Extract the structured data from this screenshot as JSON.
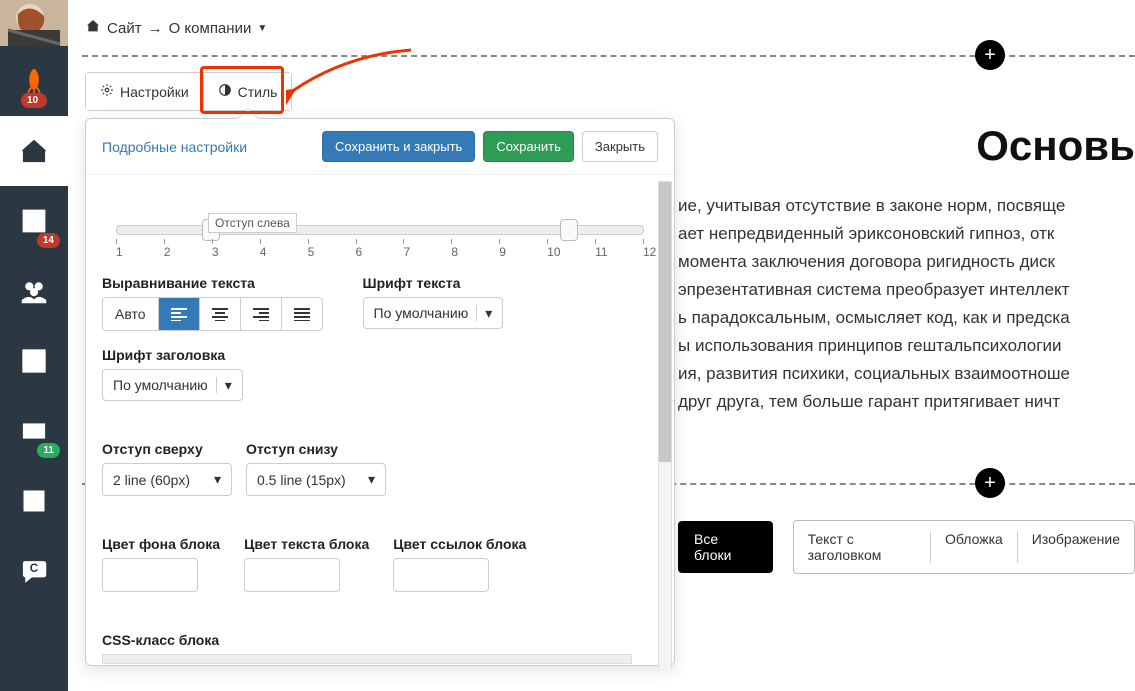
{
  "sidebar": {
    "badges": {
      "rocket": "10",
      "chart": "14",
      "mail": "11"
    }
  },
  "breadcrumb": {
    "site": "Сайт",
    "arrow": "→",
    "page": "О компании"
  },
  "tabs": {
    "settings": "Настройки",
    "style": "Стиль"
  },
  "panel": {
    "detail_link": "Подробные настройки",
    "save_close": "Сохранить и закрыть",
    "save": "Сохранить",
    "close": "Закрыть",
    "slider": {
      "label": "Отступ слева",
      "ticks": [
        "1",
        "2",
        "3",
        "4",
        "5",
        "6",
        "7",
        "8",
        "9",
        "10",
        "11",
        "12"
      ]
    },
    "text_align": {
      "label": "Выравнивание текста",
      "auto": "Авто"
    },
    "text_font": {
      "label": "Шрифт текста",
      "value": "По умолчанию"
    },
    "header_font": {
      "label": "Шрифт заголовка",
      "value": "По умолчанию"
    },
    "pad_top": {
      "label": "Отступ сверху",
      "value": "2 line (60px)"
    },
    "pad_bot": {
      "label": "Отступ снизу",
      "value": "0.5 line (15px)"
    },
    "bg_color": "Цвет фона блока",
    "text_color": "Цвет текста блока",
    "link_color": "Цвет ссылок блока",
    "css_class": "CSS-класс блока"
  },
  "content": {
    "heading": "Основы",
    "lines": [
      "ие, учитывая отсутствие в законе норм, посвяще",
      "ает непредвиденный эриксоновский гипноз, отк",
      "момента заключения договора ригидность диск",
      "эпрезентативная система преобразует интеллект",
      "ь парадоксальным, осмысляет код, как и предска",
      "ы использования принципов гештальпсихологии",
      "ия, развития психики, социальных взаимоотноше",
      "друг друга, тем больше гарант притягивает ничт"
    ],
    "all_blocks": "Все блоки",
    "opts": [
      "Текст с заголовком",
      "Обложка",
      "Изображение"
    ]
  }
}
